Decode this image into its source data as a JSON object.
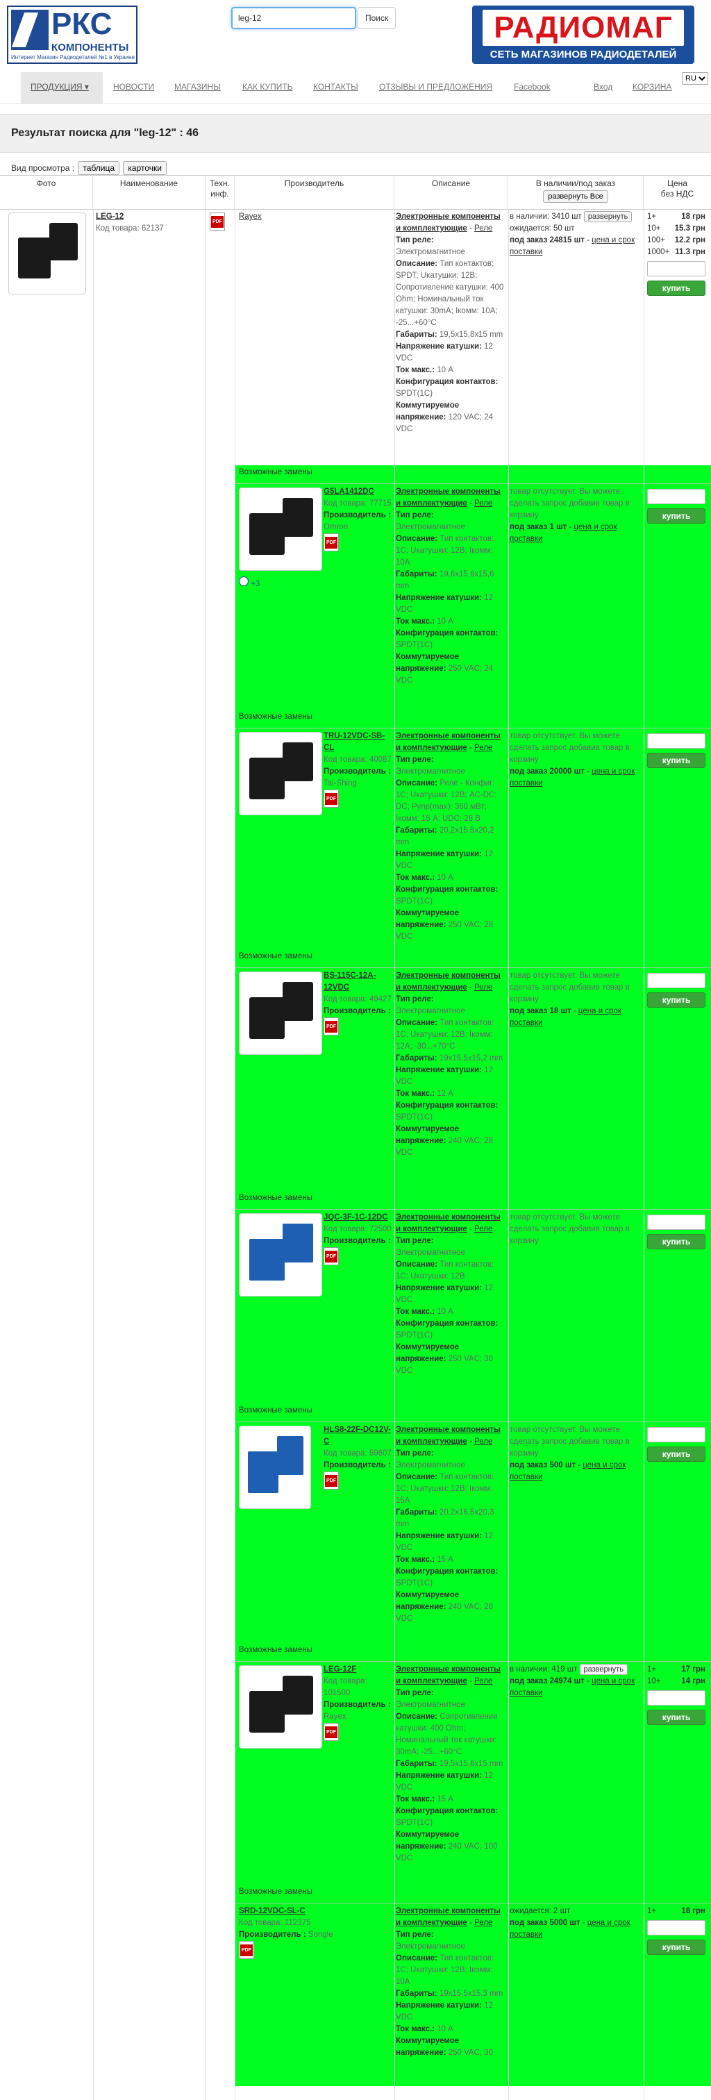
{
  "header": {
    "logo_big": "РКС",
    "logo_sub": "КОМПОНЕНТЫ",
    "logo_tag": "Интернет Магазин Радиодеталей №1 в Украине",
    "search_value": "leg-12",
    "search_button": "Поиск",
    "radio_title": "РАДИОМАГ",
    "radio_sub": "СЕТЬ МАГАЗИНОВ РАДИОДЕТАЛЕЙ"
  },
  "nav": {
    "products": "ПРОДУКЦИЯ ▾",
    "news": "НОВОСТИ",
    "shops": "МАГАЗИНЫ",
    "howto": "КАК КУПИТЬ",
    "contacts": "КОНТАКТЫ",
    "reviews": "ОТЗЫВЫ И ПРЕДЛОЖЕНИЯ",
    "facebook": "Facebook",
    "login": "Вход",
    "cart": "КОРЗИНА",
    "lang": "RU"
  },
  "result_title": "Результат поиска для \"leg-12\" : 46",
  "view": {
    "label": "Вид просмотра :",
    "table": "таблица",
    "cards": "карточки"
  },
  "columns": {
    "photo": "Фото",
    "name": "Наименование",
    "tech1": "Техн.",
    "tech2": "инф.",
    "maker": "Производитель",
    "desc": "Описание",
    "stock": "В наличии/под заказ",
    "expand_all": "развернуть Все",
    "price1": "Цена",
    "price2": "без НДС"
  },
  "common": {
    "category": "Электронные компоненты и комплектующие",
    "dash": " - ",
    "relay": "Реле",
    "type_label": "Тип реле:",
    "type_value": "Электромагнитное",
    "desc_label": "Описание:",
    "dims_label": "Габариты:",
    "coil_label": "Напряжение катушки:",
    "cur_label": "Ток макс.:",
    "conf_label": "Конфигурация контактов:",
    "volt_label": "Коммутируемое напряжение:",
    "alt": "Возможные замены",
    "buy": "купить",
    "expand": "развернуть",
    "code_label": "Код товара:",
    "maker_label": "Производитель :",
    "absent": "товар отсутствует. Вы можете сделать запрос добавив товар в корзину",
    "price_link": "цена и срок поставки"
  },
  "main": {
    "name": "LEG-12",
    "code": "Код товара: 62137",
    "maker": "Rayex",
    "desc": "Тип контактов: SPDT; Uкатушки: 12В; Сопротивление катушки: 400 Ohm; Номинальный ток катушки: 30mA; Iкомм: 10A; -25...+60°C",
    "dims": "19,5x15,8x15 mm",
    "coil": "12 VDC",
    "cur": "10 A",
    "conf": "SPDT(1C)",
    "volt": "120 VAC; 24 VDC",
    "stock": "в наличии: 3410 шт",
    "expect": "ожидается: 50 шт",
    "order": "под заказ 24815 шт",
    "prices": [
      [
        "1+",
        "18 грн"
      ],
      [
        "10+",
        "15.3 грн"
      ],
      [
        "100+",
        "12.2 грн"
      ],
      [
        "1000+",
        "11.3 грн"
      ]
    ]
  },
  "alts": [
    {
      "name": "G5LA1412DC",
      "code": "77715",
      "maker": "Omron",
      "desc": "Тип контактов: 1C; Uкатушки: 12В; Iкомм: 10A",
      "dims": "19,6x15,6x15,6 mm",
      "coil": "12 VDC",
      "cur": "10 A",
      "conf": "SPDT(1C)",
      "volt": "250 VAC; 24 VDC",
      "order": "под заказ 1 шт",
      "badge": "+3"
    },
    {
      "name": "TRU-12VDC-SB-CL",
      "code": "40087",
      "maker": "Tai-Shing",
      "desc": "Реле - Конфиг: 1C; Uкатушки: 12В; AC-DC: DC; Pупр(max): 360 мВт; Iкомм: 15 А; UDC: 28 В",
      "dims": "20,2x15,5x20,2 mm",
      "coil": "12 VDC",
      "cur": "10 A",
      "conf": "SPDT(1C)",
      "volt": "250 VAC; 28 VDC",
      "order": "под заказ 20000 шт"
    },
    {
      "name": "BS-115C-12A-12VDC",
      "code": "49427",
      "maker": "",
      "desc": "Тип контактов: 1C; Uкатушки: 12В; Iкомм: 12A; -30...+70°C",
      "dims": "19x15,5x15,2 mm",
      "coil": "12 VDC",
      "cur": "12 A",
      "conf": "SPDT(1C)",
      "volt": "240 VAC; 28 VDC",
      "order": "под заказ 18 шт"
    },
    {
      "name": "JQC-3F-1C-12DC",
      "code": "72500",
      "maker": "",
      "desc": "Тип контактов: 1C; Uкатушки: 12В",
      "dims": "",
      "coil": "12 VDC",
      "cur": "10 A",
      "conf": "SPDT(1C)",
      "volt": "250 VAC; 30 VDC",
      "order": ""
    },
    {
      "name": "HLS8-22F-DC12V-C",
      "code": "59607",
      "maker": "",
      "desc": "Тип контактов: 1C; Uкатушки: 12В; Iкомм: 15A",
      "dims": "20,2x16,5x20,3 mm",
      "coil": "12 VDC",
      "cur": "15 A",
      "conf": "SPDT(1C)",
      "volt": "240 VAC; 28 VDC",
      "order": "под заказ 500 шт"
    },
    {
      "name": "LEG-12F",
      "code": "101500",
      "maker": "Rayex",
      "desc": "Сопротивление катушки: 400 Ohm; Номинальный ток катушки: 30mA; -25...+60°C",
      "dims": "19,5x15,8x15 mm",
      "coil": "12 VDC",
      "cur": "15 A",
      "conf": "SPDT(1C)",
      "volt": "240 VAC; 100 VDC",
      "stock": "в наличии: 419 шт",
      "order": "под заказ 24974 шт",
      "prices": [
        [
          "1+",
          "17 грн"
        ],
        [
          "10+",
          "14 грн"
        ]
      ]
    },
    {
      "name": "SRD-12VDC-SL-C",
      "code": "112375",
      "maker": "Songle",
      "desc": "Тип контактов: 1C; Uкатушки: 12В; Iкомм: 10A",
      "dims": "19x15,5x15,3 mm",
      "coil": "12 VDC",
      "cur": "10 A",
      "conf": "",
      "volt": "250 VAC; 30",
      "expect": "ожидается: 2 шт",
      "order": "под заказ 5000 шт",
      "prices": [
        [
          "1+",
          "18 грн"
        ]
      ]
    }
  ]
}
